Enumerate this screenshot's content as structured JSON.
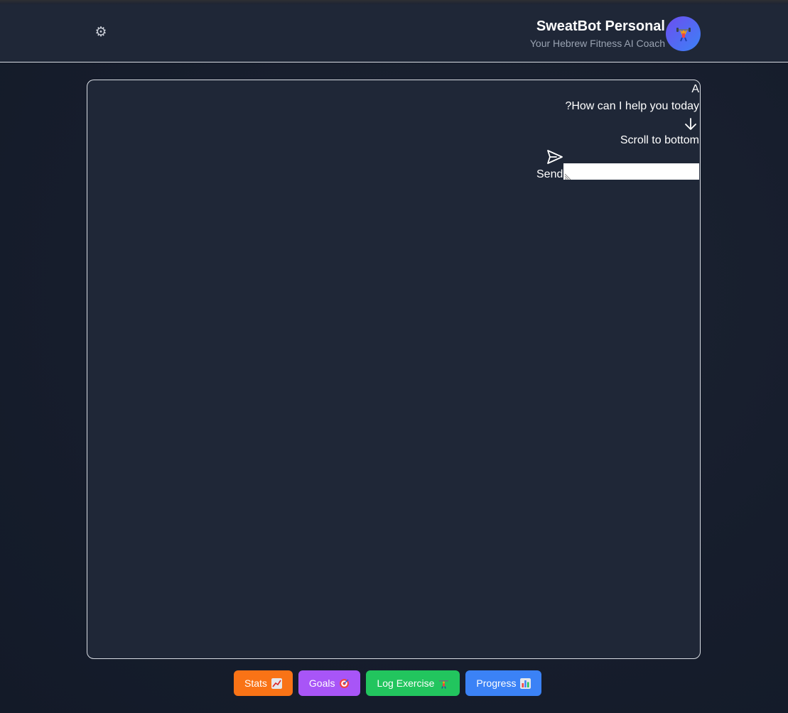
{
  "header": {
    "title": "SweatBot Personal",
    "subtitle": "Your Hebrew Fitness AI Coach",
    "settings_icon": "gear-icon",
    "avatar_icon": "weightlifter-icon"
  },
  "chat": {
    "avatar_letter": "A",
    "message": "?How can I help you today",
    "scroll_label": "Scroll to bottom",
    "send_label": "Send",
    "input_value": ""
  },
  "actions": [
    {
      "label": "Stats",
      "icon": "chart-up-icon",
      "color": "#f97316"
    },
    {
      "label": "Goals",
      "icon": "target-icon",
      "color": "#a855f7"
    },
    {
      "label": "Log Exercise",
      "icon": "weightlifter-icon",
      "color": "#22c55e"
    },
    {
      "label": "Progress",
      "icon": "bar-chart-icon",
      "color": "#3b82f6"
    }
  ]
}
